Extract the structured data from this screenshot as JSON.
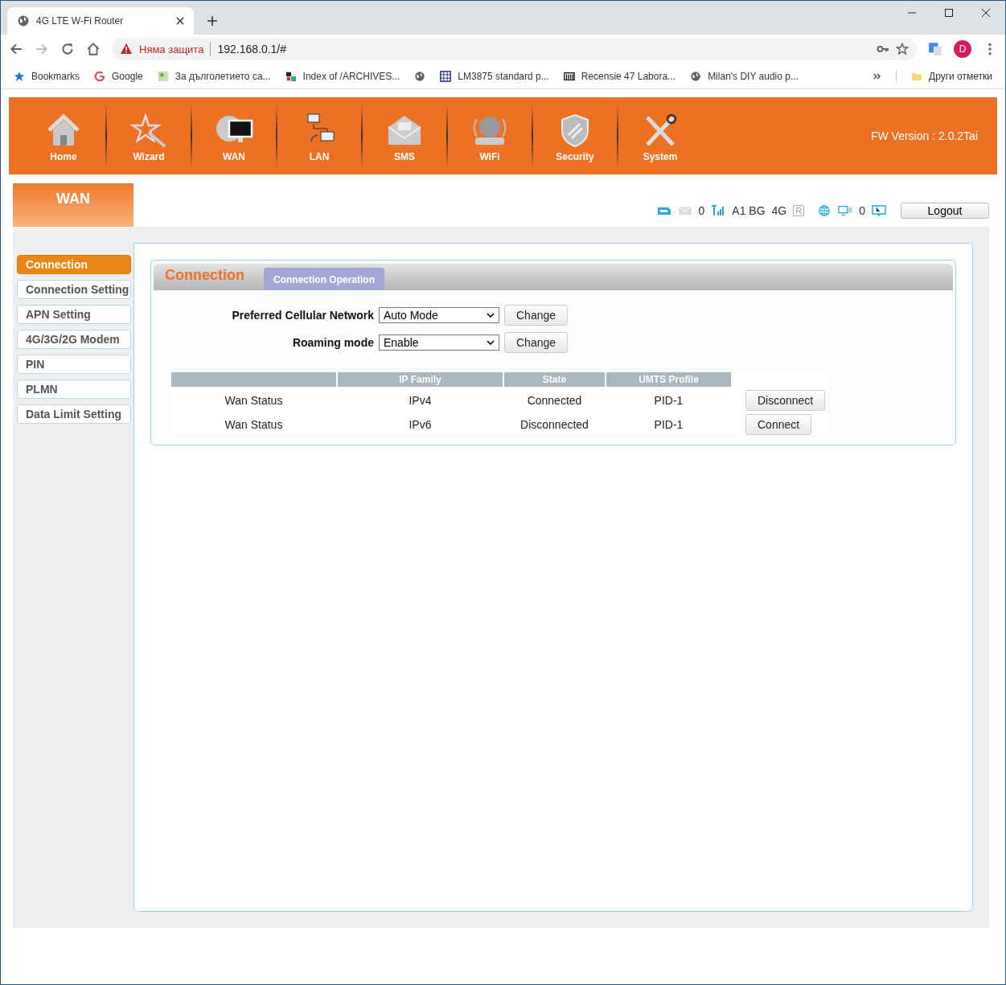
{
  "browser": {
    "tab_title": "4G LTE W-Fi Router",
    "security": "Няма защита",
    "url": "192.168.0.1/#",
    "profile_initial": "D",
    "bookmarks": [
      {
        "kind": "labeled",
        "label": "Bookmarks"
      },
      {
        "kind": "labeled",
        "label": "Google"
      },
      {
        "kind": "labeled",
        "label": "За дълголетието са..."
      },
      {
        "kind": "labeled",
        "label": "Index of /ARCHIVES..."
      },
      {
        "kind": "icon"
      },
      {
        "kind": "labeled",
        "label": "LM3875 standard p..."
      },
      {
        "kind": "labeled",
        "label": "Recensie 47 Labora..."
      },
      {
        "kind": "labeled",
        "label": "Milan's DIY audio p..."
      }
    ],
    "other_bookmarks": "Други отметки"
  },
  "router": {
    "nav": [
      "Home",
      "Wizard",
      "WAN",
      "LAN",
      "SMS",
      "WiFi",
      "Security",
      "System"
    ],
    "fw_version": "FW Version : 2.0.2Tai",
    "page_title": "WAN",
    "status": {
      "mail_count": "0",
      "operator": "A1 BG",
      "network": "4G",
      "roaming": "R",
      "clients": "0"
    },
    "logout": "Logout",
    "sidebar": [
      {
        "label": "Connection",
        "selected": true
      },
      {
        "label": "Connection Setting",
        "selected": false
      },
      {
        "label": "APN Setting",
        "selected": false
      },
      {
        "label": "4G/3G/2G Modem",
        "selected": false
      },
      {
        "label": "PIN",
        "selected": false
      },
      {
        "label": "PLMN",
        "selected": false
      },
      {
        "label": "Data Limit Setting",
        "selected": false
      }
    ],
    "panel_title": "Connection",
    "tabs": [
      {
        "label": "Connection Operation",
        "selected": true
      }
    ],
    "settings": [
      {
        "label": "Preferred Cellular Network",
        "value": "Auto Mode",
        "button": "Change"
      },
      {
        "label": "Roaming mode",
        "value": "Enable",
        "button": "Change"
      }
    ],
    "table": {
      "columns": [
        "",
        "IP Family",
        "State",
        "UMTS Profile"
      ],
      "rows": [
        {
          "name": "Wan Status",
          "ip_family": "IPv4",
          "state": "Connected",
          "profile": "PID-1",
          "action": "Disconnect"
        },
        {
          "name": "Wan Status",
          "ip_family": "IPv6",
          "state": "Disconnected",
          "profile": "PID-1",
          "action": "Connect"
        }
      ]
    }
  }
}
